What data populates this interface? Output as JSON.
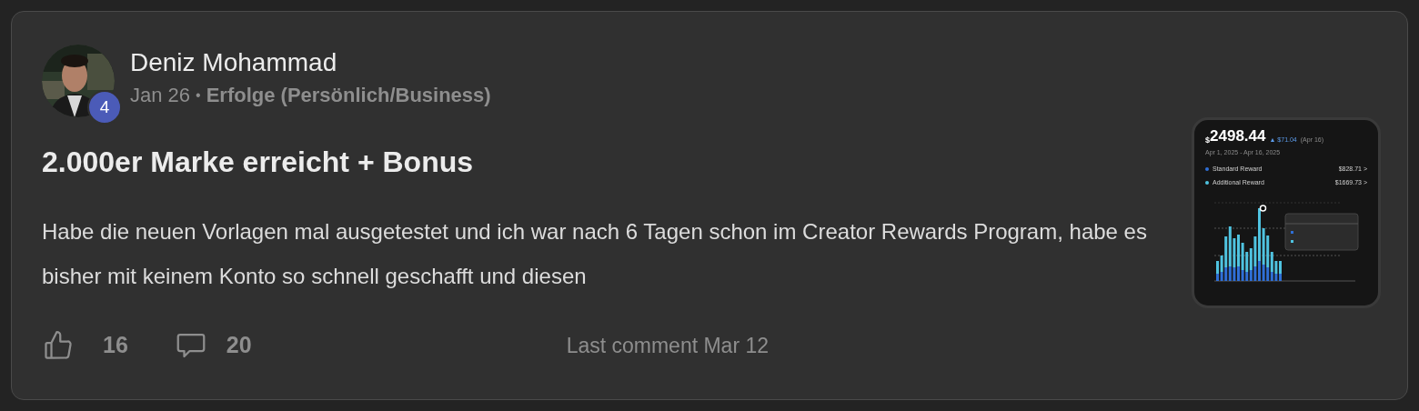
{
  "post": {
    "author": "Deniz Mohammad",
    "level_badge": "4",
    "date": "Jan 26",
    "separator": "•",
    "category": "Erfolge (Persönlich/Business)",
    "title": "2.000er Marke erreicht + Bonus",
    "body": "Habe die neuen Vorlagen mal ausgetestet und ich war nach 6 Tagen schon im Creator Rewards Program, habe es bisher mit keinem Konto so schnell geschafft und diesen",
    "likes": "16",
    "comments": "20",
    "last_comment": "Last comment Mar 12"
  },
  "attachment": {
    "total_prefix": "$",
    "total": "2498.44",
    "change": "▲ $71.04",
    "change_date": "(Apr 16)",
    "range": "Apr 1, 2025 - Apr 16, 2025",
    "legend": [
      {
        "label": "Standard Reward",
        "value": "$828.71 >",
        "color": "#2f6fd6"
      },
      {
        "label": "Additional Reward",
        "value": "$1669.73 >",
        "color": "#4fc3e0"
      }
    ]
  }
}
